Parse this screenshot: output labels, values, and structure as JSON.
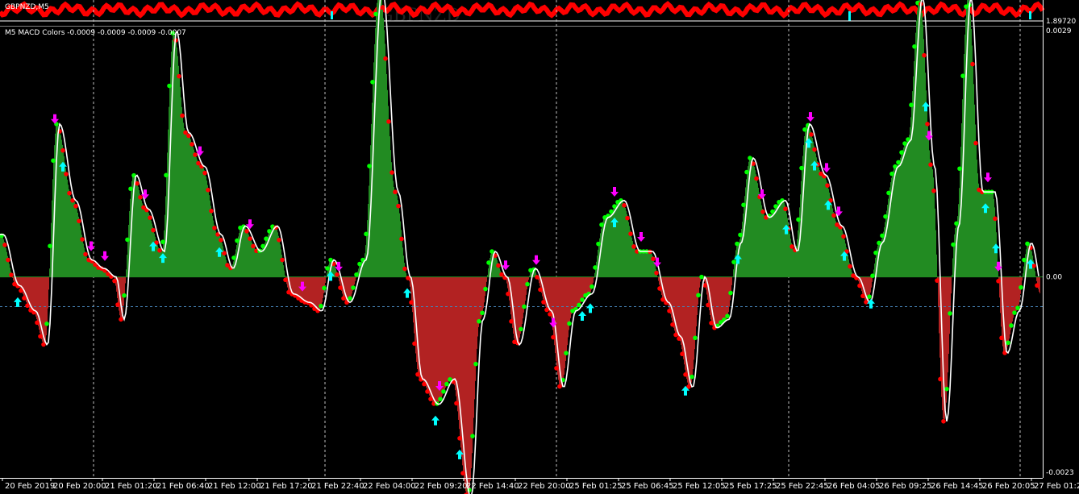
{
  "main_window": {
    "symbol_label": "GBPNZD,M5",
    "watermark": "GBPNZD",
    "price_label": "1.89720"
  },
  "indicator": {
    "title": "M5 MACD Colors -0.0009 -0.0009 -0.0009 -0.0007",
    "scale_top": "0.0029",
    "scale_zero": "0.00",
    "scale_bottom": "-0.0023"
  },
  "time_axis": [
    "20 Feb 2019",
    "20 Feb 20:00",
    "21 Feb 01:20",
    "21 Feb 06:40",
    "21 Feb 12:00",
    "21 Feb 17:20",
    "21 Feb 22:40",
    "22 Feb 04:00",
    "22 Feb 09:20",
    "22 Feb 14:40",
    "22 Feb 20:00",
    "25 Feb 01:25",
    "25 Feb 06:45",
    "25 Feb 12:05",
    "25 Feb 17:25",
    "25 Feb 22:45",
    "26 Feb 04:05",
    "26 Feb 09:25",
    "26 Feb 14:45",
    "26 Feb 20:05",
    "27 Feb 01:25"
  ],
  "colors": {
    "bg": "#000000",
    "pos_hist": "#228B22",
    "neg_hist": "#B22222",
    "macd_line": "#FFFFFF",
    "dot_up": "#00FF00",
    "dot_down": "#FF0000",
    "arrow_up": "#00FFFF",
    "arrow_down": "#FF00FF",
    "grid": "#C0C0C0",
    "level": "#4682B4"
  },
  "chart_data": {
    "type": "area",
    "title": "M5 MACD Colors -0.0009 -0.0009 -0.0009 -0.0007",
    "ylim": [
      -0.0023,
      0.0029
    ],
    "x": [
      0,
      20,
      40,
      55,
      70,
      90,
      110,
      125,
      140,
      150,
      165,
      180,
      200,
      215,
      230,
      250,
      270,
      285,
      300,
      320,
      340,
      360,
      380,
      395,
      410,
      430,
      450,
      470,
      490,
      505,
      520,
      540,
      560,
      580,
      595,
      610,
      625,
      640,
      660,
      680,
      695,
      710,
      730,
      750,
      770,
      790,
      805,
      825,
      840,
      855,
      870,
      885,
      900,
      915,
      930,
      950,
      970,
      985,
      1000,
      1020,
      1040,
      1060,
      1075,
      1090,
      1110,
      1125,
      1140,
      1155,
      1170,
      1185,
      1200,
      1215,
      1230,
      1245,
      1260,
      1275,
      1290
    ],
    "values": [
      0.0005,
      -0.0001,
      -0.0004,
      -0.0008,
      0.0018,
      0.0009,
      0.0002,
      0.0001,
      0.0,
      -0.0005,
      0.0012,
      0.0008,
      0.0003,
      0.0029,
      0.0017,
      0.0013,
      0.0005,
      0.0001,
      0.0006,
      0.0003,
      0.0006,
      -0.0002,
      -0.0003,
      -0.0004,
      0.0002,
      -0.0003,
      0.0002,
      0.0034,
      0.001,
      0.0,
      -0.0012,
      -0.0015,
      -0.0012,
      -0.0026,
      -0.0005,
      0.0003,
      0.0,
      -0.0008,
      0.0001,
      -0.0004,
      -0.0013,
      -0.0004,
      -0.0002,
      0.0007,
      0.0009,
      0.0003,
      0.0003,
      -0.0003,
      -0.0007,
      -0.0013,
      0.0,
      -0.0006,
      -0.0005,
      0.0004,
      0.0014,
      0.0007,
      0.0009,
      0.0003,
      0.0018,
      0.0012,
      0.0006,
      0.0,
      -0.0003,
      0.0004,
      0.0013,
      0.0016,
      0.0033,
      0.0013,
      -0.0017,
      0.0006,
      0.0033,
      0.001,
      0.001,
      -0.0009,
      -0.0004,
      0.0004,
      -0.0002
    ]
  }
}
